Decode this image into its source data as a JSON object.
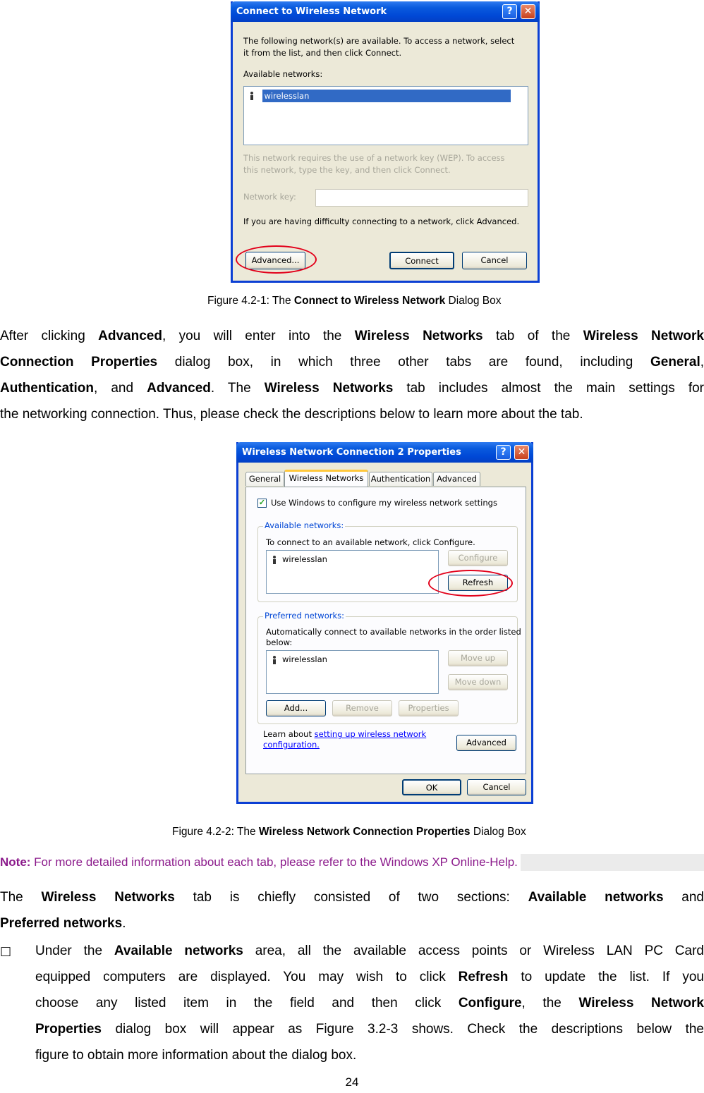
{
  "figure1": {
    "title": "Connect to Wireless Network",
    "intro_line1": "The following network(s) are available. To access a network, select",
    "intro_line2": "it from the list, and then click Connect.",
    "available_label": "Available networks:",
    "network": "wirelesslan",
    "wep_line1": "This network requires the use of a network key (WEP). To access",
    "wep_line2": "this network, type the key, and then click Connect.",
    "key_label": "Network key:",
    "difficulty": "If you are having difficulty connecting to a network, click Advanced.",
    "advanced_btn": "Advanced...",
    "connect_btn": "Connect",
    "cancel_btn": "Cancel"
  },
  "caption1": {
    "prefix": "Figure 4.2-1: The ",
    "bold": "Connect to Wireless Network",
    "suffix": " Dialog Box"
  },
  "para1": {
    "l1a": "After clicking ",
    "l1b": "Advanced",
    "l1c": ", you will enter into the ",
    "l1d": "Wireless Networks",
    "l1e": " tab of the ",
    "l1f": "Wireless Network",
    "l2a": "Connection Properties",
    "l2b": " dialog box, in which three other tabs are found, including ",
    "l2c": "General",
    "l2d": ",",
    "l3a": "Authentication",
    "l3b": ", and ",
    "l3c": "Advanced",
    "l3d": ". The ",
    "l3e": "Wireless Networks",
    "l3f": " tab includes almost the main settings for",
    "l4": "the networking connection. Thus, please check the descriptions below to learn more about the tab."
  },
  "figure2": {
    "title": "Wireless Network Connection 2 Properties",
    "tabs": [
      "General",
      "Wireless Networks",
      "Authentication",
      "Advanced"
    ],
    "use_windows": "Use Windows to configure my wireless network settings",
    "available_group": "Available networks:",
    "available_text": "To connect to an available network, click Configure.",
    "available_network": "wirelesslan",
    "configure_btn": "Configure",
    "refresh_btn": "Refresh",
    "preferred_group": "Preferred networks:",
    "preferred_text1": "Automatically connect to available networks in the order listed",
    "preferred_text2": "below:",
    "preferred_network": "wirelesslan",
    "moveup_btn": "Move up",
    "movedown_btn": "Move down",
    "add_btn": "Add...",
    "remove_btn": "Remove",
    "properties_btn": "Properties",
    "learn_prefix": "Learn about ",
    "learn_link1": "setting up wireless network",
    "learn_link2": "configuration.",
    "advanced_btn": "Advanced",
    "ok_btn": "OK",
    "cancel_btn": "Cancel"
  },
  "caption2": {
    "prefix": "Figure 4.2-2: The ",
    "bold": "Wireless Network Connection Properties",
    "suffix": " Dialog Box"
  },
  "note": {
    "label": "Note:",
    "text": " For more detailed information about each tab, please refer to the Windows XP Online-Help.",
    "color": "#8b1a8b"
  },
  "para2": {
    "l1a": "The ",
    "l1b": "Wireless Networks",
    "l1c": " tab is chiefly consisted of two sections: ",
    "l1d": "Available networks",
    "l1e": " and",
    "l2a": "Preferred networks",
    "l2b": "."
  },
  "bullet": {
    "symbol": "□",
    "l1a": "Under the ",
    "l1b": "Available networks",
    "l1c": " area, all the available access points or Wireless LAN PC Card",
    "l2a": "equipped computers are displayed. You may wish to click ",
    "l2b": "Refresh",
    "l2c": " to update the list. If you",
    "l3a": "choose any listed item in the field and then click ",
    "l3b": "Configure",
    "l3c": ", the ",
    "l3d": "Wireless Network",
    "l4a": "Properties",
    "l4b": " dialog box will appear as Figure 3.2-3 shows. Check the descriptions below the",
    "l5": "figure to obtain more information about the dialog box."
  },
  "page_number": "24"
}
